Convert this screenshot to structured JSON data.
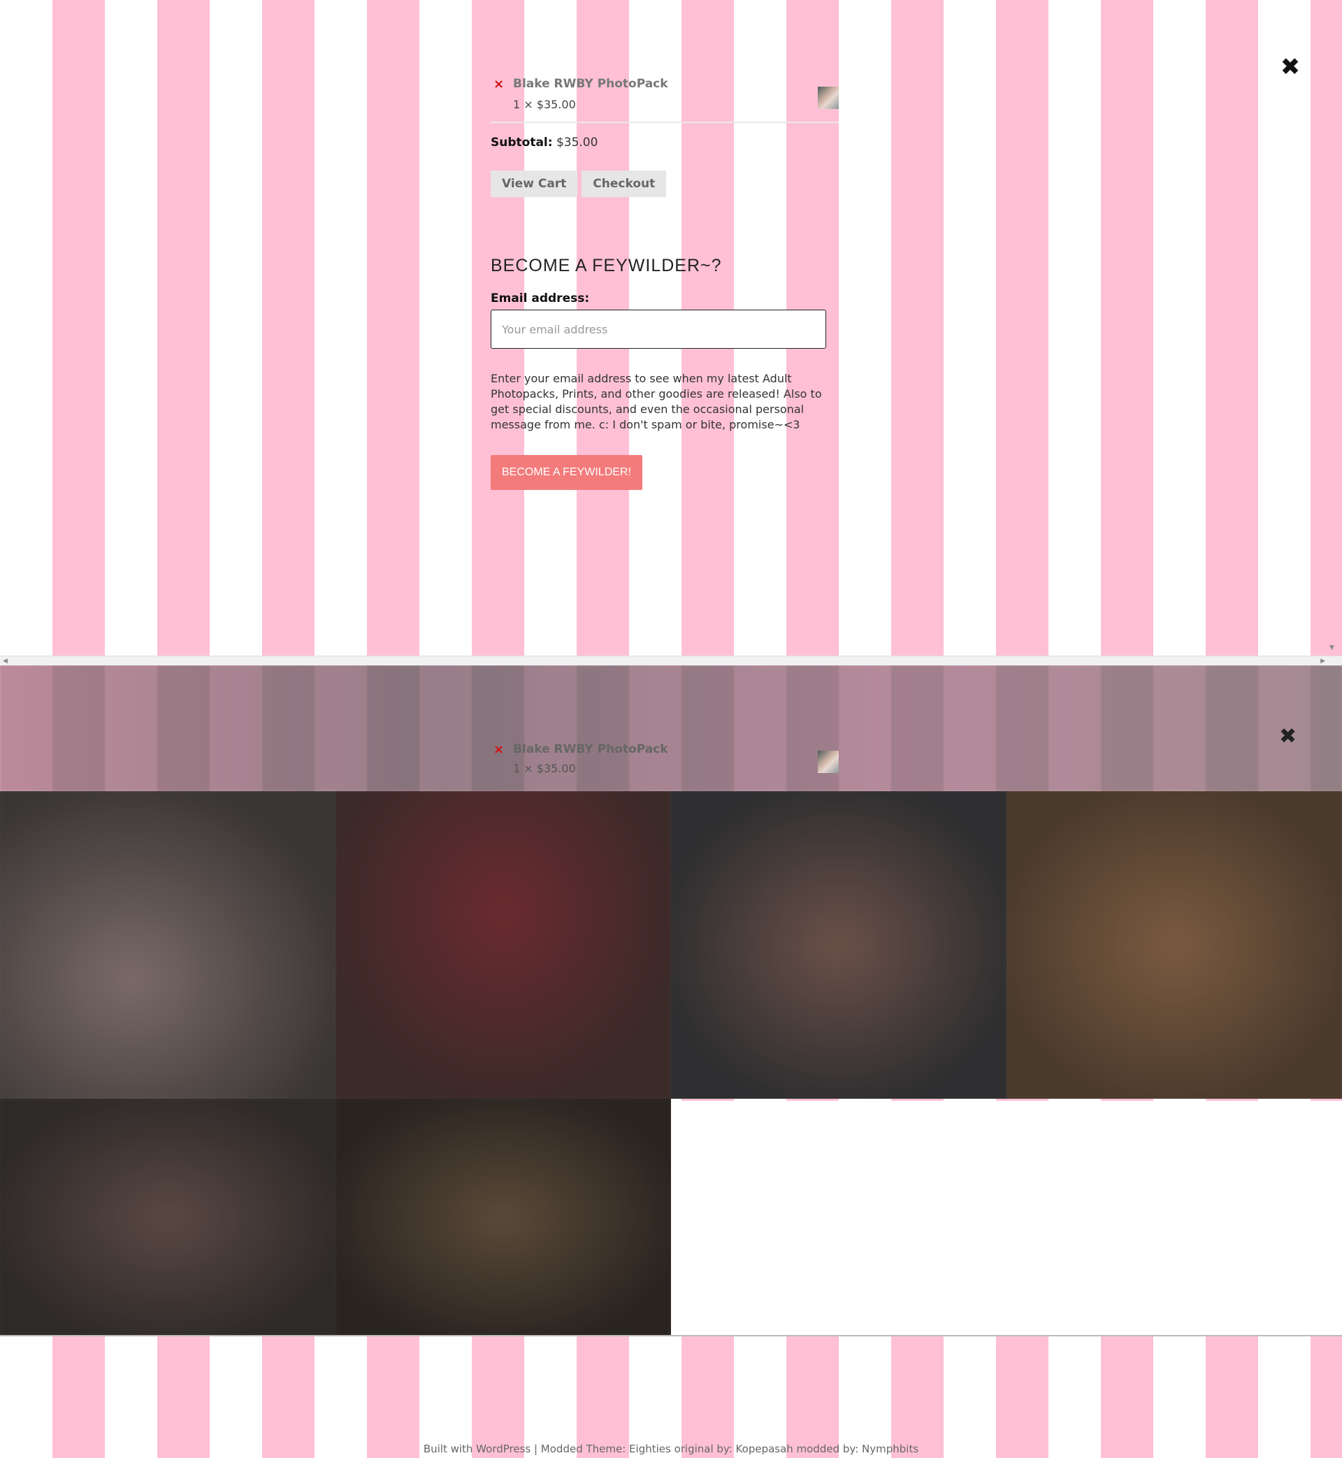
{
  "close_icon": "✖",
  "cart": {
    "remove_icon": "×",
    "item_name": "Blake RWBY PhotoPack",
    "item_qty": "1 × $35.00",
    "subtotal_label": "Subtotal:",
    "subtotal_value": "$35.00",
    "view_cart_label": "View Cart",
    "checkout_label": "Checkout"
  },
  "signup": {
    "title": "BECOME A FEYWILDER~?",
    "email_label": "Email address:",
    "email_placeholder": "Your email address",
    "email_value": "",
    "description": "Enter your email address to see when my latest Adult Photopacks, Prints, and other goodies are released! Also to get special discounts, and even the occasional personal message from me. c: I don't spam or bite, promise~<3",
    "button_label": "BECOME A FEYWILDER!"
  },
  "colors": {
    "stripe_pink": "#ffc0d6",
    "signup_button": "#f47b7b",
    "remove_red": "#d01010"
  },
  "footer": {
    "text": "Built with WordPress | Modded Theme: Eighties original by: Kopepasah modded by: Nymphbits"
  }
}
